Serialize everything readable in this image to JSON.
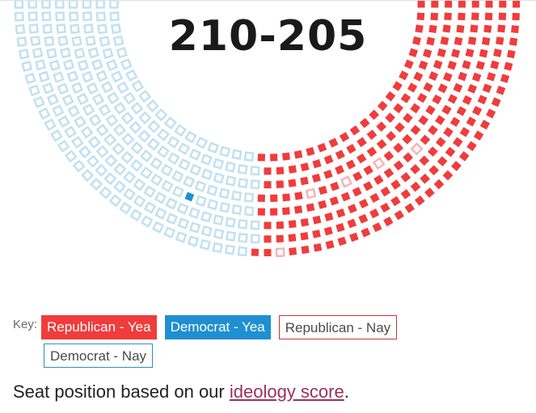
{
  "tally": "210-205",
  "key": {
    "label": "Key:",
    "items": [
      {
        "label": "Republican - Yea",
        "class": "rep-yea",
        "name": "key-republican-yea"
      },
      {
        "label": "Democrat - Yea",
        "class": "dem-yea",
        "name": "key-democrat-yea"
      },
      {
        "label": "Republican - Nay",
        "class": "rep-nay",
        "name": "key-republican-nay"
      },
      {
        "label": "Democrat - Nay",
        "class": "dem-nay",
        "name": "key-democrat-nay"
      }
    ]
  },
  "footnote": {
    "prefix": "Seat position based on our ",
    "link": "ideology score",
    "suffix": "."
  },
  "chart_data": {
    "type": "parliament",
    "title": "210-205",
    "series": [
      {
        "name": "Republican - Yea",
        "value": 209,
        "color": "#f03c3c"
      },
      {
        "name": "Democrat - Yea",
        "value": 1,
        "color": "#1f8fd1"
      },
      {
        "name": "Republican - Nay",
        "value": 5,
        "color": "#f6b3b3"
      },
      {
        "name": "Democrat - Nay",
        "value": 200,
        "color": "#bfe0f3"
      }
    ]
  }
}
